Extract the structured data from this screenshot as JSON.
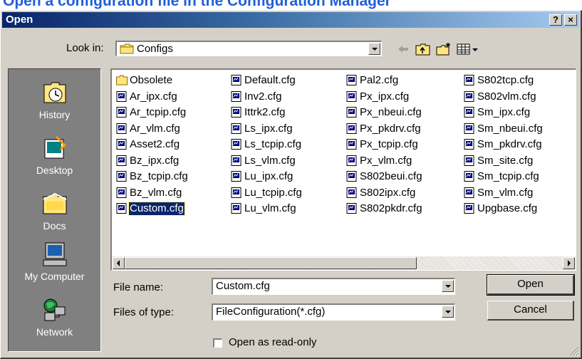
{
  "background_caption": "Open a configuration file in the Configuration Manager",
  "window": {
    "title": "Open",
    "help_button": "?",
    "close_button": "×"
  },
  "look_in": {
    "label": "Look in:",
    "value": "Configs"
  },
  "places": [
    {
      "label": "History",
      "icon": "history-icon"
    },
    {
      "label": "Desktop",
      "icon": "desktop-icon"
    },
    {
      "label": "Docs",
      "icon": "docs-folder-icon"
    },
    {
      "label": "My Computer",
      "icon": "my-computer-icon"
    },
    {
      "label": "Network",
      "icon": "network-icon"
    }
  ],
  "files": {
    "columns": [
      [
        "Obsolete",
        "Ar_ipx.cfg",
        "Ar_tcpip.cfg",
        "Ar_vlm.cfg",
        "Asset2.cfg",
        "Bz_ipx.cfg",
        "Bz_tcpip.cfg",
        "Bz_vlm.cfg",
        "Custom.cfg"
      ],
      [
        "Default.cfg",
        "Inv2.cfg",
        "Ittrk2.cfg",
        "Ls_ipx.cfg",
        "Ls_tcpip.cfg",
        "Ls_vlm.cfg",
        "Lu_ipx.cfg",
        "Lu_tcpip.cfg",
        "Lu_vlm.cfg"
      ],
      [
        "Pal2.cfg",
        "Px_ipx.cfg",
        "Px_nbeui.cfg",
        "Px_pkdrv.cfg",
        "Px_tcpip.cfg",
        "Px_vlm.cfg",
        "S802beui.cfg",
        "S802ipx.cfg",
        "S802pkdr.cfg"
      ],
      [
        "S802tcp.cfg",
        "S802vlm.cfg",
        "Sm_ipx.cfg",
        "Sm_nbeui.cfg",
        "Sm_pkdrv.cfg",
        "Sm_site.cfg",
        "Sm_tcpip.cfg",
        "Sm_vlm.cfg",
        "Upgbase.cfg"
      ]
    ],
    "folder_item": "Obsolete",
    "selected_item": "Custom.cfg"
  },
  "file_name": {
    "label": "File name:",
    "value": "Custom.cfg"
  },
  "file_type": {
    "label": "Files of type:",
    "value": "FileConfiguration(*.cfg)"
  },
  "read_only": {
    "label": "Open as read-only",
    "checked": false
  },
  "buttons": {
    "open": "Open",
    "cancel": "Cancel"
  },
  "colors": {
    "titlebar_start": "#0a246a",
    "titlebar_end": "#a6caf0",
    "face": "#d4d0c8",
    "places_bar": "#808080",
    "selection": "#0a246a",
    "caption_blue": "#1f5fd8"
  }
}
